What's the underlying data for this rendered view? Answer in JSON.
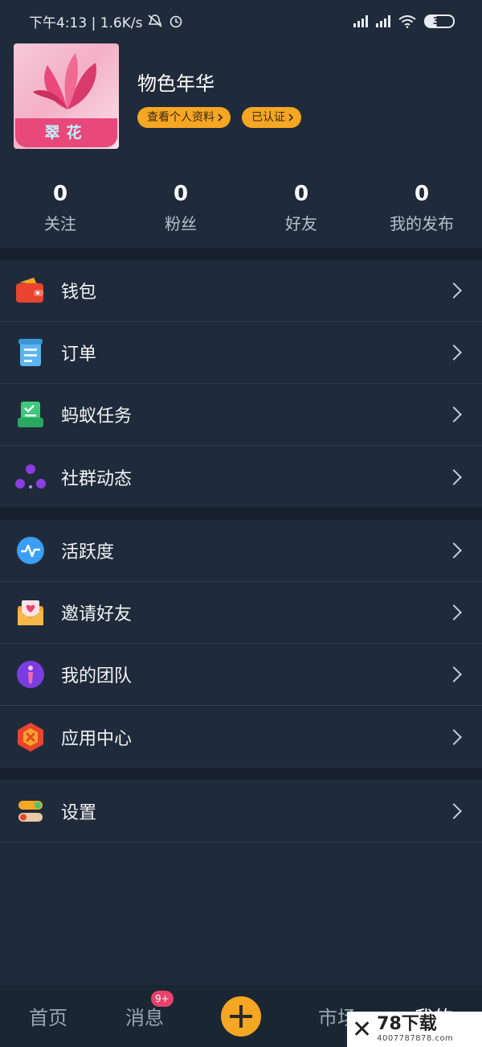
{
  "status_bar": {
    "time_speed": "下午4:13 | 1.6K/s",
    "battery": "30"
  },
  "profile": {
    "avatar_text": "翠花",
    "username": "物色年华",
    "view_profile": "查看个人资料",
    "verified": "已认证"
  },
  "stats": [
    {
      "value": "0",
      "label": "关注"
    },
    {
      "value": "0",
      "label": "粉丝"
    },
    {
      "value": "0",
      "label": "好友"
    },
    {
      "value": "0",
      "label": "我的发布"
    }
  ],
  "menu": {
    "group1": [
      {
        "label": "钱包",
        "icon": "wallet-icon"
      },
      {
        "label": "订单",
        "icon": "order-icon"
      },
      {
        "label": "蚂蚁任务",
        "icon": "task-icon"
      },
      {
        "label": "社群动态",
        "icon": "community-icon"
      }
    ],
    "group2": [
      {
        "label": "活跃度",
        "icon": "activity-icon"
      },
      {
        "label": "邀请好友",
        "icon": "invite-icon"
      },
      {
        "label": "我的团队",
        "icon": "team-icon"
      },
      {
        "label": "应用中心",
        "icon": "app-center-icon"
      }
    ],
    "group3": [
      {
        "label": "设置",
        "icon": "settings-icon"
      }
    ]
  },
  "bottom_nav": {
    "home": "首页",
    "messages": "消息",
    "messages_badge": "9+",
    "market": "市场",
    "mine": "我的"
  },
  "watermark": {
    "title": "78下载",
    "sub": "4007787878.com"
  },
  "colors": {
    "background": "#1f2b3a",
    "accent": "#f5a623",
    "badge": "#e8426b"
  }
}
